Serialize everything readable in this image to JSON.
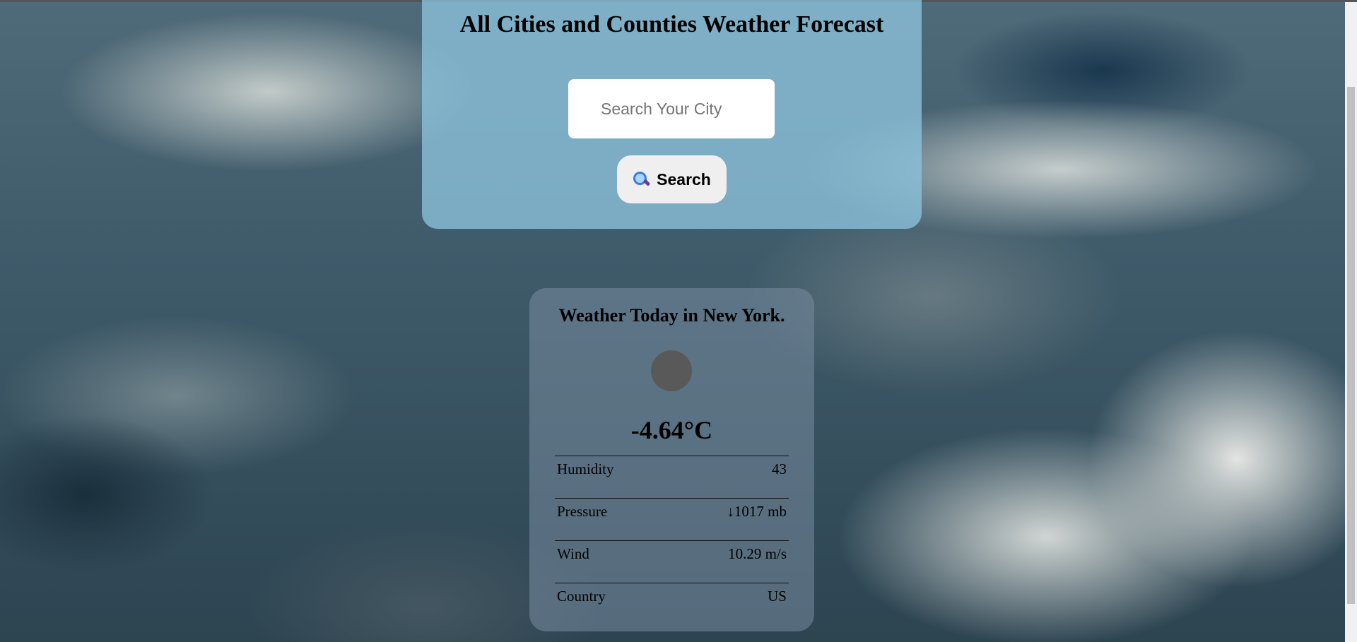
{
  "header": {
    "title": "All Cities and Counties Weather Forecast",
    "search_placeholder": "Search Your City",
    "search_value": "",
    "search_button_label": "Search",
    "search_button_icon": "magnifier-icon"
  },
  "weather": {
    "title": "Weather Today in New York.",
    "icon": "weather-condition-icon",
    "temperature": "-4.64°C",
    "stats": [
      {
        "label": "Humidity",
        "value": "43"
      },
      {
        "label": "Pressure",
        "value": "↓1017 mb"
      },
      {
        "label": "Wind",
        "value": "10.29 m/s"
      },
      {
        "label": "Country",
        "value": "US"
      }
    ]
  }
}
